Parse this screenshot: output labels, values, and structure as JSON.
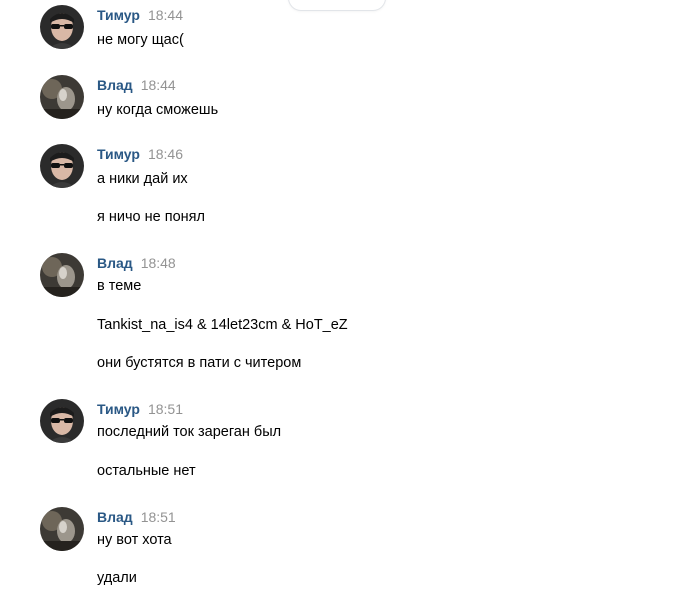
{
  "messages": [
    {
      "author": "Тимур",
      "avatar": "timur-avatar",
      "time": "18:44",
      "lines": [
        "не могу щас("
      ]
    },
    {
      "author": "Влад",
      "avatar": "vlad-avatar",
      "time": "18:44",
      "lines": [
        "ну когда сможешь"
      ]
    },
    {
      "author": "Тимур",
      "avatar": "timur-avatar",
      "time": "18:46",
      "lines": [
        "а ники дай их",
        "я ничо не понял"
      ]
    },
    {
      "author": "Влад",
      "avatar": "vlad-avatar",
      "time": "18:48",
      "lines": [
        "в теме",
        "Tankist_na_is4 & 14let23cm & HoT_eZ",
        "они бустятся в пати с читером"
      ]
    },
    {
      "author": "Тимур",
      "avatar": "timur-avatar",
      "time": "18:51",
      "lines": [
        "последний ток зареган был",
        "остальные нет"
      ]
    },
    {
      "author": "Влад",
      "avatar": "vlad-avatar",
      "time": "18:51",
      "lines": [
        "ну вот хота",
        "удали"
      ]
    }
  ],
  "colors": {
    "author": "#2a5885",
    "time": "#939393",
    "text": "#000000",
    "background": "#ffffff"
  }
}
